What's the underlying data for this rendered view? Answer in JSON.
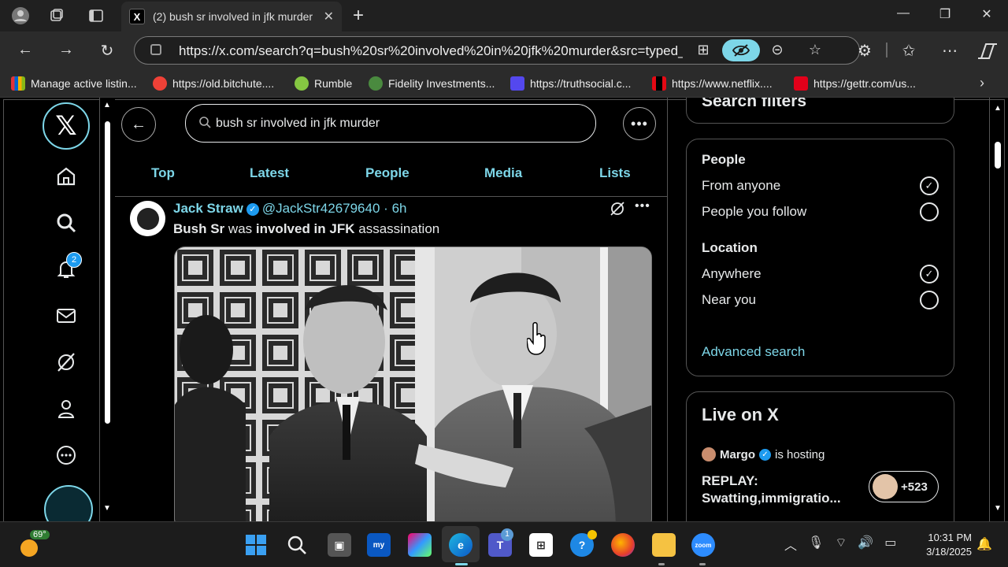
{
  "browser": {
    "tab_title": "(2) bush sr involved in jfk murder",
    "tab_favicon": "X",
    "url": "https://x.com/search?q=bush%20sr%20involved%20in%20jfk%20murder&src=typed_...",
    "bookmarks": [
      {
        "label": "Manage active listin...",
        "icon": "ebay-icon",
        "color": "#e53238"
      },
      {
        "label": "https://old.bitchute....",
        "icon": "bitchute-icon",
        "color": "#ef4137"
      },
      {
        "label": "Rumble",
        "icon": "rumble-icon",
        "color": "#85c742"
      },
      {
        "label": "Fidelity Investments...",
        "icon": "fidelity-icon",
        "color": "#4a8a3f"
      },
      {
        "label": "https://truthsocial.c...",
        "icon": "truthsocial-icon",
        "color": "#5448ee"
      },
      {
        "label": "https://www.netflix....",
        "icon": "netflix-icon",
        "color": "#e50914"
      },
      {
        "label": "https://gettr.com/us...",
        "icon": "gettr-icon",
        "color": "#e2001a"
      }
    ]
  },
  "x": {
    "notification_count": "2",
    "search_value": "bush sr involved in jfk murder",
    "tabs": [
      "Top",
      "Latest",
      "People",
      "Media",
      "Lists"
    ],
    "post": {
      "author_name": "Jack Straw",
      "handle": "@JackStr42679640",
      "separator": "·",
      "time": "6h",
      "text_parts": [
        "Bush Sr",
        " was ",
        "involved in JFK",
        " assassination"
      ]
    },
    "filters": {
      "title": "Search filters",
      "people_heading": "People",
      "people_options": [
        "From anyone",
        "People you follow"
      ],
      "location_heading": "Location",
      "location_options": [
        "Anywhere",
        "Near you"
      ],
      "advanced_link": "Advanced search"
    },
    "live": {
      "title": "Live on X",
      "host_name": "Margo",
      "host_suffix": "is hosting",
      "replay_title": "REPLAY: Swatting,immigratio...",
      "listener_count": "+523"
    },
    "accent_color": "#7dd6e8"
  },
  "taskbar": {
    "weather_temp": "69°",
    "teams_badge": "1",
    "time": "10:31 PM",
    "date": "3/18/2025"
  }
}
